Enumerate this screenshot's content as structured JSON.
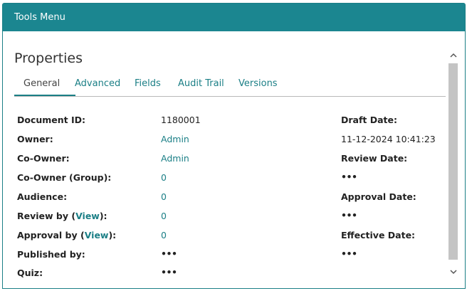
{
  "header": {
    "title": "Tools Menu"
  },
  "panel": {
    "title": "Properties"
  },
  "tabs": [
    {
      "label": "General",
      "active": true
    },
    {
      "label": "Advanced"
    },
    {
      "label": "Fields"
    },
    {
      "label": "Audit Trail"
    },
    {
      "label": "Versions"
    }
  ],
  "left": {
    "document_id_label": "Document ID:",
    "document_id_value": "1180001",
    "owner_label": "Owner:",
    "owner_value": "Admin",
    "co_owner_label": "Co-Owner:",
    "co_owner_value": "Admin",
    "co_owner_group_label": "Co-Owner (Group):",
    "co_owner_group_value": "0",
    "audience_label": "Audience:",
    "audience_value": "0",
    "review_by_label_pre": "Review by (",
    "review_by_view": "View",
    "review_by_label_post": "):",
    "review_by_value": "0",
    "approval_by_label_pre": "Approval by (",
    "approval_by_view": "View",
    "approval_by_label_post": "):",
    "approval_by_value": "0",
    "published_by_label": "Published by:",
    "published_by_value": "•••",
    "quiz_label": "Quiz:",
    "quiz_value": "•••"
  },
  "right": {
    "draft_date_label": "Draft Date:",
    "draft_date_value": "11-12-2024 10:41:23",
    "review_date_label": "Review Date:",
    "review_date_value": "•••",
    "approval_date_label": "Approval Date:",
    "approval_date_value": "•••",
    "effective_date_label": "Effective Date:",
    "effective_date_value": "•••"
  },
  "scrollbar": {
    "up_glyph": "⌃",
    "down_glyph": "⌄"
  },
  "colors": {
    "accent": "#1b8690",
    "link": "#1b7f86"
  }
}
